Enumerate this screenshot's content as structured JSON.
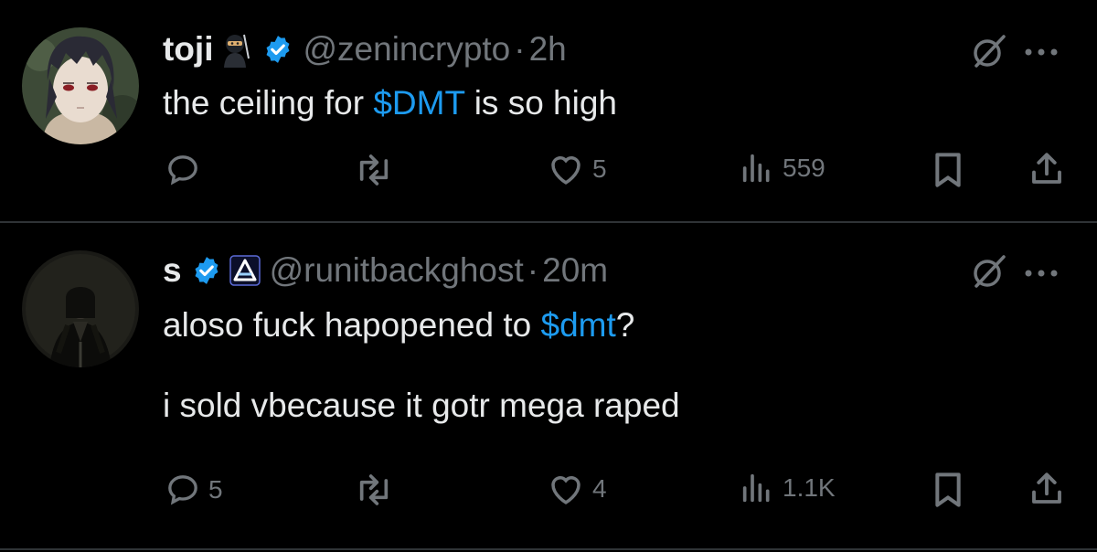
{
  "tweets": [
    {
      "name": "toji",
      "handle": "@zenincrypto",
      "separator": "·",
      "time": "2h",
      "text_before": "the ceiling for ",
      "cashtag": "$DMT",
      "text_after": " is so high",
      "replies": "",
      "reposts": "",
      "likes": "5",
      "views": "559",
      "avatar_icon": "anime-character-avatar",
      "emoji_icon": "ninja-emoji"
    },
    {
      "name": "s",
      "handle": "@runitbackghost",
      "separator": "·",
      "time": "20m",
      "text_before": "aloso fuck hapopened to ",
      "cashtag": "$dmt",
      "text_after": "?\n\ni sold vbecause it gotr mega raped",
      "replies": "5",
      "reposts": "",
      "likes": "4",
      "views": "1.1K",
      "avatar_icon": "dark-figure-avatar",
      "emoji_icon": "affiliate-badge"
    }
  ],
  "colors": {
    "background": "#000000",
    "text": "#e7e9ea",
    "muted": "#71767b",
    "accent": "#1d9bf0",
    "divider": "#2f3336"
  }
}
